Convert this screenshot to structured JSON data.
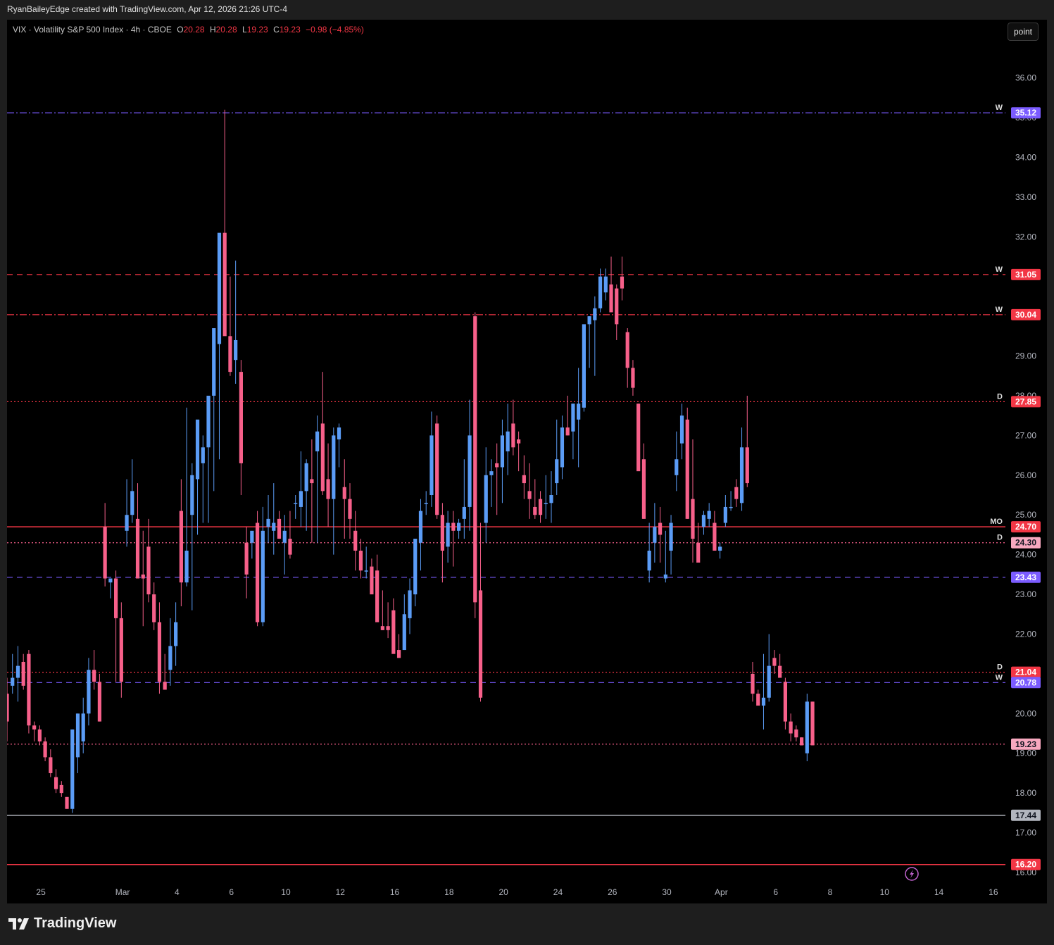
{
  "credit": "RyanBaileyEdge created with TradingView.com, Apr 12, 2026 21:26 UTC-4",
  "legend": {
    "symbol": "VIX · Volatility S&P 500 Index · 4h · CBOE",
    "o_label": "O",
    "o": "20.28",
    "h_label": "H",
    "h": "20.28",
    "l_label": "L",
    "l": "19.23",
    "c_label": "C",
    "c": "19.23",
    "change": "−0.98 (−4.85%)"
  },
  "point_button": "point",
  "brand": "TradingView",
  "colors": {
    "up": "#5b9cf6",
    "down": "#f7608a",
    "red_line": "#f23645",
    "purple_line": "#7b5cff",
    "gray_line": "#b2b5be",
    "axis_text": "#b2b5be",
    "background": "#000000"
  },
  "chart_data": {
    "type": "candlestick",
    "symbol": "VIX",
    "interval": "4h",
    "ylim": [
      15.9,
      36.8
    ],
    "y_ticks": [
      "16.00",
      "17.00",
      "18.00",
      "19.00",
      "20.00",
      "21.00",
      "22.00",
      "23.00",
      "24.00",
      "25.00",
      "26.00",
      "27.00",
      "28.00",
      "29.00",
      "30.00",
      "31.00",
      "32.00",
      "33.00",
      "34.00",
      "35.00",
      "36.00"
    ],
    "x_ticks": [
      {
        "label": "25",
        "bar": 7
      },
      {
        "label": "Mar",
        "bar": 22
      },
      {
        "label": "4",
        "bar": 32
      },
      {
        "label": "6",
        "bar": 42
      },
      {
        "label": "10",
        "bar": 52
      },
      {
        "label": "12",
        "bar": 62
      },
      {
        "label": "16",
        "bar": 72
      },
      {
        "label": "18",
        "bar": 82
      },
      {
        "label": "20",
        "bar": 92
      },
      {
        "label": "24",
        "bar": 102
      },
      {
        "label": "26",
        "bar": 112
      },
      {
        "label": "30",
        "bar": 122
      },
      {
        "label": "Apr",
        "bar": 132
      },
      {
        "label": "6",
        "bar": 142
      },
      {
        "label": "8",
        "bar": 152
      },
      {
        "label": "10",
        "bar": 162
      },
      {
        "label": "14",
        "bar": 172
      },
      {
        "label": "16",
        "bar": 182
      }
    ],
    "candles": [
      [
        20.5,
        20.9,
        19.3,
        19.8
      ],
      [
        20.7,
        21.5,
        20.5,
        20.9
      ],
      [
        20.9,
        21.7,
        20.3,
        21.2
      ],
      [
        21.3,
        21.5,
        20.6,
        20.7
      ],
      [
        21.5,
        21.6,
        19.5,
        19.7
      ],
      [
        19.7,
        19.8,
        19.3,
        19.6
      ],
      [
        19.6,
        19.7,
        19.2,
        19.3
      ],
      [
        19.3,
        19.4,
        18.8,
        18.9
      ],
      [
        18.9,
        19.1,
        18.4,
        18.5
      ],
      [
        18.4,
        18.6,
        18.0,
        18.1
      ],
      [
        18.2,
        18.3,
        17.9,
        18.0
      ],
      [
        17.9,
        17.9,
        17.6,
        17.6
      ],
      [
        17.6,
        19.6,
        17.5,
        19.6
      ],
      [
        18.9,
        20.0,
        18.5,
        20.0
      ],
      [
        19.3,
        20.4,
        19.0,
        20.0
      ],
      [
        20.0,
        21.4,
        19.7,
        21.1
      ],
      [
        21.1,
        21.6,
        20.6,
        20.8
      ],
      [
        20.8,
        21.0,
        19.8,
        19.8
      ],
      [
        24.7,
        25.3,
        23.2,
        23.4
      ],
      [
        23.3,
        23.4,
        22.9,
        23.4
      ],
      [
        23.4,
        23.6,
        20.8,
        22.4
      ],
      [
        22.4,
        22.8,
        20.4,
        20.8
      ],
      [
        24.6,
        25.9,
        24.2,
        25.0
      ],
      [
        25.0,
        26.4,
        24.8,
        25.6
      ],
      [
        24.9,
        25.8,
        23.5,
        23.4
      ],
      [
        23.5,
        24.6,
        22.2,
        23.4
      ],
      [
        24.2,
        24.9,
        22.8,
        23.0
      ],
      [
        23.0,
        23.3,
        22.1,
        22.3
      ],
      [
        22.3,
        22.8,
        20.5,
        20.8
      ],
      [
        20.8,
        21.5,
        20.6,
        20.6
      ],
      [
        21.1,
        22.4,
        20.7,
        21.7
      ],
      [
        21.7,
        22.8,
        21.2,
        22.3
      ],
      [
        25.1,
        25.9,
        22.7,
        23.3
      ],
      [
        23.3,
        27.7,
        23.2,
        24.1
      ],
      [
        25.0,
        26.3,
        22.6,
        26.0
      ],
      [
        25.9,
        26.9,
        24.5,
        27.4
      ],
      [
        26.3,
        27.0,
        24.8,
        26.7
      ],
      [
        26.7,
        27.2,
        24.8,
        28.0
      ],
      [
        28.0,
        29.0,
        25.6,
        29.7
      ],
      [
        29.3,
        30.1,
        26.4,
        32.1
      ],
      [
        32.1,
        35.2,
        30.2,
        29.5
      ],
      [
        29.5,
        31.0,
        28.5,
        28.6
      ],
      [
        28.9,
        31.4,
        28.3,
        29.4
      ],
      [
        28.6,
        28.9,
        25.5,
        26.3
      ],
      [
        24.3,
        24.7,
        22.9,
        23.5
      ],
      [
        24.3,
        24.5,
        23.9,
        24.6
      ],
      [
        24.8,
        25.1,
        22.2,
        22.3
      ],
      [
        22.3,
        25.2,
        22.2,
        24.6
      ],
      [
        24.7,
        25.5,
        24.3,
        24.9
      ],
      [
        24.6,
        25.8,
        24.0,
        24.8
      ],
      [
        24.9,
        25.1,
        24.4,
        24.4
      ],
      [
        24.3,
        25.0,
        23.5,
        24.6
      ],
      [
        24.4,
        25.1,
        23.9,
        24.0
      ],
      [
        25.3,
        25.5,
        24.9,
        25.3
      ],
      [
        25.2,
        26.6,
        24.7,
        25.6
      ],
      [
        25.6,
        26.4,
        24.6,
        26.3
      ],
      [
        25.9,
        26.9,
        24.3,
        25.8
      ],
      [
        26.6,
        27.5,
        24.3,
        27.1
      ],
      [
        27.3,
        28.6,
        25.5,
        25.6
      ],
      [
        25.9,
        26.8,
        24.7,
        25.4
      ],
      [
        25.4,
        27.2,
        24.0,
        27.0
      ],
      [
        26.9,
        27.3,
        26.2,
        27.2
      ],
      [
        25.7,
        26.4,
        24.4,
        25.4
      ],
      [
        25.4,
        25.8,
        24.4,
        24.9
      ],
      [
        24.6,
        25.1,
        23.6,
        24.1
      ],
      [
        24.1,
        24.4,
        23.4,
        23.6
      ],
      [
        23.6,
        24.2,
        23.4,
        23.6
      ],
      [
        23.7,
        23.9,
        23.5,
        23.0
      ],
      [
        23.6,
        24.0,
        22.3,
        22.3
      ],
      [
        22.2,
        23.1,
        22.1,
        22.1
      ],
      [
        22.2,
        22.8,
        21.9,
        22.1
      ],
      [
        22.6,
        22.9,
        21.7,
        21.5
      ],
      [
        21.6,
        22.0,
        21.4,
        21.4
      ],
      [
        21.6,
        23.0,
        21.6,
        22.5
      ],
      [
        22.4,
        23.4,
        22.0,
        23.1
      ],
      [
        23.0,
        23.9,
        22.7,
        24.4
      ],
      [
        24.3,
        25.4,
        23.6,
        25.1
      ],
      [
        25.3,
        25.6,
        25.0,
        25.3
      ],
      [
        25.5,
        27.6,
        25.2,
        27.0
      ],
      [
        27.3,
        27.5,
        24.9,
        25.0
      ],
      [
        25.0,
        25.3,
        23.3,
        24.1
      ],
      [
        24.2,
        25.1,
        23.8,
        24.8
      ],
      [
        24.8,
        25.1,
        23.7,
        24.6
      ],
      [
        24.6,
        24.9,
        24.4,
        24.8
      ],
      [
        24.9,
        26.4,
        24.4,
        25.2
      ],
      [
        25.2,
        27.9,
        24.6,
        27.0
      ],
      [
        30.0,
        30.1,
        22.4,
        22.8
      ],
      [
        23.1,
        24.8,
        20.3,
        20.4
      ],
      [
        24.8,
        26.7,
        24.3,
        26.0
      ],
      [
        26.0,
        26.4,
        25.2,
        26.1
      ],
      [
        26.3,
        26.8,
        25.0,
        26.2
      ],
      [
        26.2,
        27.4,
        25.3,
        27.0
      ],
      [
        26.6,
        27.8,
        26.0,
        27.1
      ],
      [
        27.3,
        27.9,
        26.5,
        26.7
      ],
      [
        26.9,
        27.1,
        26.1,
        26.8
      ],
      [
        26.0,
        26.5,
        25.4,
        25.8
      ],
      [
        25.6,
        26.3,
        24.9,
        25.4
      ],
      [
        25.2,
        25.9,
        24.9,
        25.0
      ],
      [
        25.4,
        25.6,
        24.8,
        25.0
      ],
      [
        25.3,
        26.0,
        24.9,
        25.3
      ],
      [
        25.3,
        26.1,
        24.8,
        25.5
      ],
      [
        25.8,
        27.4,
        25.5,
        26.4
      ],
      [
        26.2,
        27.5,
        25.9,
        27.2
      ],
      [
        27.2,
        28.0,
        27.0,
        27.0
      ],
      [
        27.1,
        27.8,
        26.4,
        27.8
      ],
      [
        27.4,
        28.7,
        26.2,
        27.8
      ],
      [
        27.7,
        29.8,
        27.6,
        29.8
      ],
      [
        29.8,
        30.0,
        28.7,
        30.0
      ],
      [
        29.9,
        30.5,
        28.5,
        30.2
      ],
      [
        30.2,
        31.2,
        30.1,
        31.0
      ],
      [
        30.6,
        31.2,
        30.4,
        31.0
      ],
      [
        30.8,
        31.5,
        30.5,
        30.1
      ],
      [
        30.7,
        30.8,
        29.4,
        29.8
      ],
      [
        31.0,
        31.5,
        30.4,
        30.7
      ],
      [
        29.6,
        29.7,
        28.2,
        28.7
      ],
      [
        28.7,
        28.9,
        28.0,
        28.2
      ],
      [
        27.8,
        27.8,
        26.3,
        26.1
      ],
      [
        26.4,
        26.8,
        24.9,
        24.9
      ],
      [
        23.6,
        24.8,
        23.3,
        24.1
      ],
      [
        24.3,
        25.3,
        23.8,
        24.7
      ],
      [
        24.8,
        25.2,
        23.8,
        24.5
      ],
      [
        23.4,
        24.6,
        23.3,
        23.5
      ],
      [
        24.1,
        25.0,
        23.5,
        24.8
      ],
      [
        26.0,
        27.1,
        25.6,
        26.4
      ],
      [
        26.8,
        27.8,
        26.4,
        27.5
      ],
      [
        27.4,
        27.7,
        24.9,
        24.9
      ],
      [
        25.4,
        26.9,
        23.8,
        24.4
      ],
      [
        24.3,
        24.8,
        23.9,
        23.8
      ],
      [
        24.7,
        25.1,
        24.5,
        25.0
      ],
      [
        24.9,
        25.3,
        24.7,
        25.1
      ],
      [
        24.8,
        25.1,
        24.2,
        24.1
      ],
      [
        24.1,
        24.3,
        23.9,
        24.2
      ],
      [
        24.8,
        25.5,
        24.7,
        25.2
      ],
      [
        25.2,
        25.6,
        25.1,
        25.2
      ],
      [
        25.7,
        25.9,
        25.2,
        25.4
      ],
      [
        25.3,
        27.2,
        25.1,
        26.7
      ],
      [
        26.7,
        28.0,
        25.7,
        25.8
      ],
      [
        21.0,
        21.3,
        20.3,
        20.5
      ],
      [
        20.5,
        20.6,
        20.2,
        20.2
      ],
      [
        20.2,
        21.5,
        19.6,
        20.4
      ],
      [
        20.4,
        22.0,
        20.3,
        21.2
      ],
      [
        21.4,
        21.6,
        21.0,
        21.2
      ],
      [
        21.2,
        21.5,
        21.0,
        20.9
      ],
      [
        20.8,
        20.9,
        19.6,
        19.8
      ],
      [
        19.8,
        20.0,
        19.3,
        19.5
      ],
      [
        19.6,
        19.7,
        19.3,
        19.4
      ],
      [
        19.4,
        19.4,
        19.2,
        19.2
      ],
      [
        19.0,
        20.5,
        18.8,
        20.3
      ],
      [
        20.3,
        20.3,
        19.2,
        19.2
      ]
    ],
    "candle_columns": [
      "open",
      "high",
      "low",
      "close"
    ],
    "levels": [
      {
        "value": 35.12,
        "label": "35.12",
        "style": "dash-dot",
        "color": "#7b5cff",
        "tag": "W"
      },
      {
        "value": 31.05,
        "label": "31.05",
        "style": "dashed",
        "color": "#f23645",
        "tag": "W"
      },
      {
        "value": 30.04,
        "label": "30.04",
        "style": "dash-dot",
        "color": "#f23645",
        "tag": "W"
      },
      {
        "value": 27.85,
        "label": "27.85",
        "style": "dotted",
        "color": "#f23645",
        "tag": "D"
      },
      {
        "value": 24.7,
        "label": "24.70",
        "style": "solid",
        "color": "#f23645",
        "tag": "MO"
      },
      {
        "value": 24.3,
        "label": "24.30",
        "style": "dotted",
        "color": "#f7608a",
        "tag": "D"
      },
      {
        "value": 23.43,
        "label": "23.43",
        "style": "dashed",
        "color": "#7b5cff",
        "tag": ""
      },
      {
        "value": 21.04,
        "label": "21.04",
        "style": "dotted",
        "color": "#f23645",
        "tag": "D"
      },
      {
        "value": 20.78,
        "label": "20.78",
        "style": "dashed",
        "color": "#7b5cff",
        "tag": "W"
      },
      {
        "value": 19.23,
        "label": "19.23",
        "style": "dotted",
        "color": "#f7608a",
        "tag": ""
      },
      {
        "value": 17.44,
        "label": "17.44",
        "style": "solid",
        "color": "#b2b5be",
        "tag": ""
      },
      {
        "value": 16.2,
        "label": "16.20",
        "style": "solid",
        "color": "#f23645",
        "tag": ""
      }
    ],
    "grid": false,
    "legend_position": "top-left"
  }
}
